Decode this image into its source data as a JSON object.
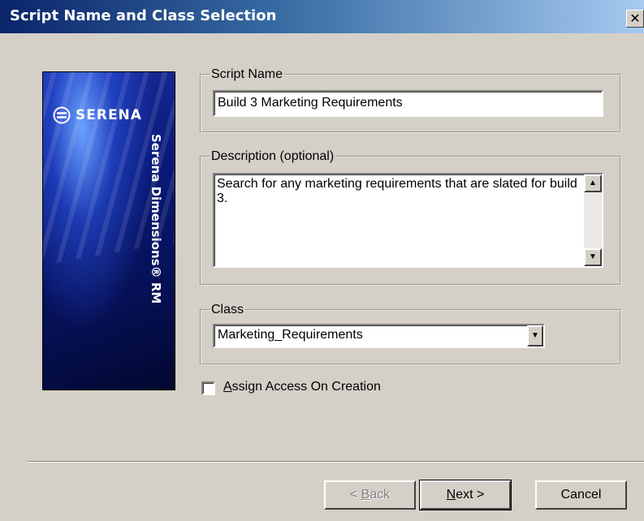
{
  "window": {
    "title": "Script Name and Class Selection",
    "close_symbol": "✕"
  },
  "banner": {
    "logo_text": "SERENA",
    "product_name": "Serena Dimensions® RM",
    "logo_icon": "serena-s-icon"
  },
  "script_name": {
    "label": "Script Name",
    "value": "Build 3 Marketing Requirements"
  },
  "description": {
    "label": "Description (optional)",
    "value": "Search for any marketing requirements that are slated for build 3."
  },
  "class": {
    "label": "Class",
    "selected": "Marketing_Requirements"
  },
  "assign_access": {
    "mnemonic": "A",
    "rest": "ssign Access On Creation",
    "checked": false
  },
  "buttons": {
    "back_symbol": "< ",
    "back_mnemonic": "B",
    "back_rest": "ack",
    "next_mnemonic": "N",
    "next_rest": "ext >",
    "cancel": "Cancel"
  },
  "colors": {
    "dialog_bg": "#d4d0c8",
    "titlebar_start": "#0a246a",
    "titlebar_end": "#a6caf0",
    "banner_blue": "#0a1a7a"
  }
}
